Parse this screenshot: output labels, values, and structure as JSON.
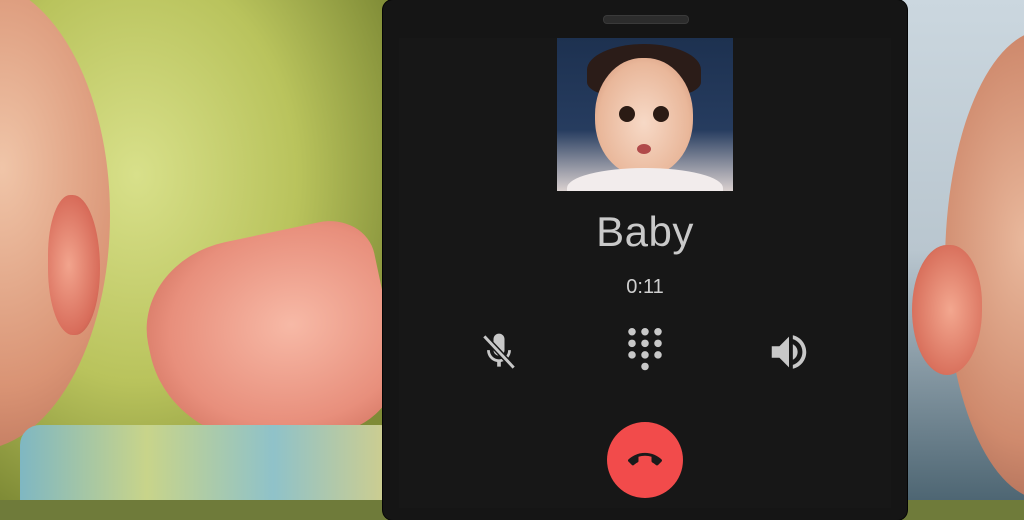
{
  "call": {
    "caller_name": "Baby",
    "duration": "0:11"
  },
  "controls": {
    "mute_icon": "mic-off-icon",
    "keypad_icon": "dialpad-icon",
    "speaker_icon": "volume-up-icon",
    "end_call_icon": "call-end-icon"
  },
  "colors": {
    "screen_bg": "#171717",
    "phone_body": "#151515",
    "end_call": "#f24b4b",
    "icon": "#c8c8c8",
    "text": "#c9c9c9"
  }
}
